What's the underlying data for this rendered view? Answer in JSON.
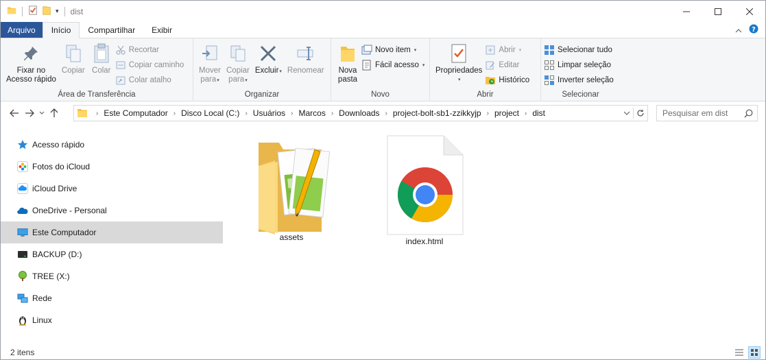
{
  "window": {
    "title": "dist"
  },
  "tabs": [
    {
      "label": "Arquivo"
    },
    {
      "label": "Início"
    },
    {
      "label": "Compartilhar"
    },
    {
      "label": "Exibir"
    }
  ],
  "ribbon": {
    "clipboard": {
      "label": "Área de Transferência",
      "pin_line1": "Fixar no",
      "pin_line2": "Acesso rápido",
      "copy": "Copiar",
      "paste": "Colar",
      "cut": "Recortar",
      "copy_path": "Copiar caminho",
      "paste_shortcut": "Colar atalho"
    },
    "organize": {
      "label": "Organizar",
      "move_line1": "Mover",
      "move_line2": "para",
      "copyto_line1": "Copiar",
      "copyto_line2": "para",
      "delete": "Excluir",
      "rename": "Renomear"
    },
    "new": {
      "label": "Novo",
      "folder_line1": "Nova",
      "folder_line2": "pasta",
      "new_item": "Novo item",
      "easy_access": "Fácil acesso"
    },
    "open": {
      "label": "Abrir",
      "properties": "Propriedades",
      "open": "Abrir",
      "edit": "Editar",
      "history": "Histórico"
    },
    "select": {
      "label": "Selecionar",
      "select_all": "Selecionar tudo",
      "select_none": "Limpar seleção",
      "invert": "Inverter seleção"
    }
  },
  "address": {
    "crumbs": [
      "Este Computador",
      "Disco Local (C:)",
      "Usuários",
      "Marcos",
      "Downloads",
      "project-bolt-sb1-zzikkyjp",
      "project",
      "dist"
    ]
  },
  "search": {
    "placeholder": "Pesquisar em dist"
  },
  "sidebar": {
    "items": [
      {
        "label": "Acesso rápido",
        "icon": "star-icon"
      },
      {
        "label": "Fotos do iCloud",
        "icon": "icloud-photos-icon"
      },
      {
        "label": "iCloud Drive",
        "icon": "icloud-drive-icon"
      },
      {
        "label": "OneDrive - Personal",
        "icon": "onedrive-icon"
      },
      {
        "label": "Este Computador",
        "icon": "computer-icon"
      },
      {
        "label": "BACKUP (D:)",
        "icon": "drive-icon"
      },
      {
        "label": "TREE (X:)",
        "icon": "tree-icon"
      },
      {
        "label": "Rede",
        "icon": "network-icon"
      },
      {
        "label": "Linux",
        "icon": "linux-icon"
      }
    ]
  },
  "files": [
    {
      "name": "assets",
      "icon": "folder-icon"
    },
    {
      "name": "index.html",
      "icon": "chrome-html-icon"
    }
  ],
  "status": {
    "count": "2 itens"
  },
  "colors": {
    "file_tab": "#1979ca",
    "selected_nav": "#d9d9d9",
    "ribbon_bg": "#f5f6f7"
  }
}
